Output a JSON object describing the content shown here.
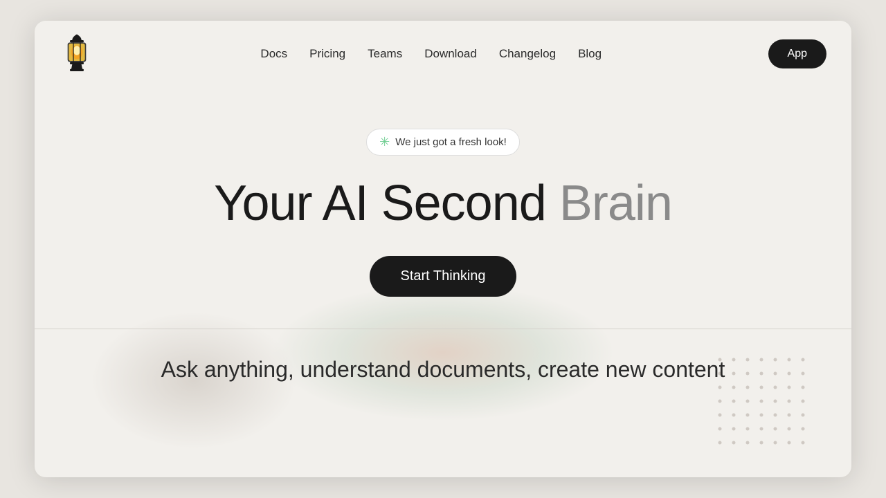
{
  "window": {
    "background": "#f2f0ec"
  },
  "navbar": {
    "logo_alt": "Lantern AI Logo",
    "links": [
      {
        "label": "Docs",
        "id": "docs"
      },
      {
        "label": "Pricing",
        "id": "pricing"
      },
      {
        "label": "Teams",
        "id": "teams"
      },
      {
        "label": "Download",
        "id": "download"
      },
      {
        "label": "Changelog",
        "id": "changelog"
      },
      {
        "label": "Blog",
        "id": "blog"
      }
    ],
    "app_button_label": "App"
  },
  "hero": {
    "badge_icon": "✳",
    "badge_text": "We just got a fresh look!",
    "title_part1": "Your AI Second ",
    "title_part2": "Brain",
    "cta_label": "Start Thinking",
    "subtitle": "Ask anything, understand documents, create new content"
  }
}
